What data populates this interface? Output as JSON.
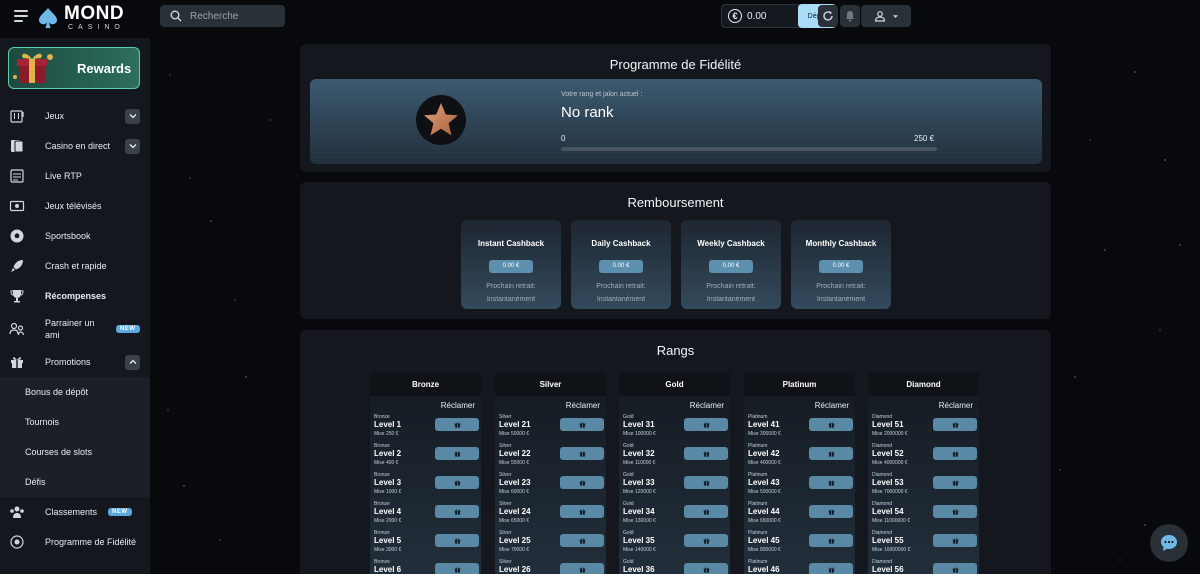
{
  "header": {
    "logo_main": "MOND",
    "logo_sub": "CASINO",
    "search_placeholder": "Recherche",
    "balance": "0.00",
    "deposit_label": "Dépôt"
  },
  "sidebar": {
    "rewards_label": "Rewards",
    "items": [
      {
        "label": "Jeux",
        "icon": "slot-machine-icon"
      },
      {
        "label": "Casino en direct",
        "icon": "cards-icon"
      },
      {
        "label": "Live RTP",
        "icon": "rtp-icon"
      },
      {
        "label": "Jeux télévisés",
        "icon": "tv-icon"
      },
      {
        "label": "Sportsbook",
        "icon": "soccer-ball-icon"
      },
      {
        "label": "Crash et rapide",
        "icon": "rocket-icon"
      },
      {
        "label": "Récompenses",
        "icon": "trophy-icon"
      },
      {
        "label": "Parrainer un ami",
        "icon": "referral-icon"
      },
      {
        "label": "Promotions",
        "icon": "gift-icon"
      }
    ],
    "promo_sub": [
      "Bonus de dépôt",
      "Tournois",
      "Courses de slots",
      "Défis"
    ],
    "classements_label": "Classements",
    "fidelite_label": "Programme de Fidélité",
    "new_badge": "NEW"
  },
  "loyalty": {
    "title": "Programme de Fidélité",
    "rank_caption": "Votre rang et jalon actuel :",
    "rank_name": "No rank",
    "progress_min": "0",
    "progress_max": "250 €",
    "progress_fraction": 0
  },
  "cashback": {
    "title": "Remboursement",
    "cards": [
      {
        "title": "Instant Cashback",
        "amount": "0.00 €",
        "next_label": "Prochain retrait:",
        "next_value": "Instantanément"
      },
      {
        "title": "Daily Cashback",
        "amount": "0.00 €",
        "next_label": "Prochain retrait:",
        "next_value": "Instantanément"
      },
      {
        "title": "Weekly Cashback",
        "amount": "0.00 €",
        "next_label": "Prochain retrait:",
        "next_value": "Instantanément"
      },
      {
        "title": "Monthly Cashback",
        "amount": "0.00 €",
        "next_label": "Prochain retrait:",
        "next_value": "Instantanément"
      }
    ]
  },
  "ranks": {
    "title": "Rangs",
    "claim_label": "Réclamer",
    "columns": [
      {
        "name": "Bronze",
        "levels": [
          {
            "tier": "Bronze",
            "name": "Level 1",
            "bet": "Mise 250 €"
          },
          {
            "tier": "Bronze",
            "name": "Level 2",
            "bet": "Mise 400 €"
          },
          {
            "tier": "Bronze",
            "name": "Level 3",
            "bet": "Mise 1000 €"
          },
          {
            "tier": "Bronze",
            "name": "Level 4",
            "bet": "Mise 2000 €"
          },
          {
            "tier": "Bronze",
            "name": "Level 5",
            "bet": "Mise 3000 €"
          },
          {
            "tier": "Bronze",
            "name": "Level 6",
            "bet": ""
          }
        ]
      },
      {
        "name": "Silver",
        "levels": [
          {
            "tier": "Silver",
            "name": "Level 21",
            "bet": "Mise 50000 €"
          },
          {
            "tier": "Silver",
            "name": "Level 22",
            "bet": "Mise 55000 €"
          },
          {
            "tier": "Silver",
            "name": "Level 23",
            "bet": "Mise 60000 €"
          },
          {
            "tier": "Silver",
            "name": "Level 24",
            "bet": "Mise 65000 €"
          },
          {
            "tier": "Silver",
            "name": "Level 25",
            "bet": "Mise 70000 €"
          },
          {
            "tier": "Silver",
            "name": "Level 26",
            "bet": ""
          }
        ]
      },
      {
        "name": "Gold",
        "levels": [
          {
            "tier": "Gold",
            "name": "Level 31",
            "bet": "Mise 100000 €"
          },
          {
            "tier": "Gold",
            "name": "Level 32",
            "bet": "Mise 110000 €"
          },
          {
            "tier": "Gold",
            "name": "Level 33",
            "bet": "Mise 120000 €"
          },
          {
            "tier": "Gold",
            "name": "Level 34",
            "bet": "Mise 130000 €"
          },
          {
            "tier": "Gold",
            "name": "Level 35",
            "bet": "Mise 140000 €"
          },
          {
            "tier": "Gold",
            "name": "Level 36",
            "bet": ""
          }
        ]
      },
      {
        "name": "Platinum",
        "levels": [
          {
            "tier": "Platinum",
            "name": "Level 41",
            "bet": "Mise 300000 €"
          },
          {
            "tier": "Platinum",
            "name": "Level 42",
            "bet": "Mise 400000 €"
          },
          {
            "tier": "Platinum",
            "name": "Level 43",
            "bet": "Mise 500000 €"
          },
          {
            "tier": "Platinum",
            "name": "Level 44",
            "bet": "Mise 650000 €"
          },
          {
            "tier": "Platinum",
            "name": "Level 45",
            "bet": "Mise 800000 €"
          },
          {
            "tier": "Platinum",
            "name": "Level 46",
            "bet": ""
          }
        ]
      },
      {
        "name": "Diamond",
        "levels": [
          {
            "tier": "Diamond",
            "name": "Level 51",
            "bet": "Mise 2000000 €"
          },
          {
            "tier": "Diamond",
            "name": "Level 52",
            "bet": "Mise 4000000 €"
          },
          {
            "tier": "Diamond",
            "name": "Level 53",
            "bet": "Mise 7000000 €"
          },
          {
            "tier": "Diamond",
            "name": "Level 54",
            "bet": "Mise 11000000 €"
          },
          {
            "tier": "Diamond",
            "name": "Level 55",
            "bet": "Mise 16000000 €"
          },
          {
            "tier": "Diamond",
            "name": "Level 56",
            "bet": ""
          }
        ]
      }
    ]
  },
  "colors": {
    "accent": "#a9dcf7",
    "claim_button": "#5a89a6",
    "new_badge": "#5aa9df",
    "rewards_border": "#57d0a8"
  }
}
